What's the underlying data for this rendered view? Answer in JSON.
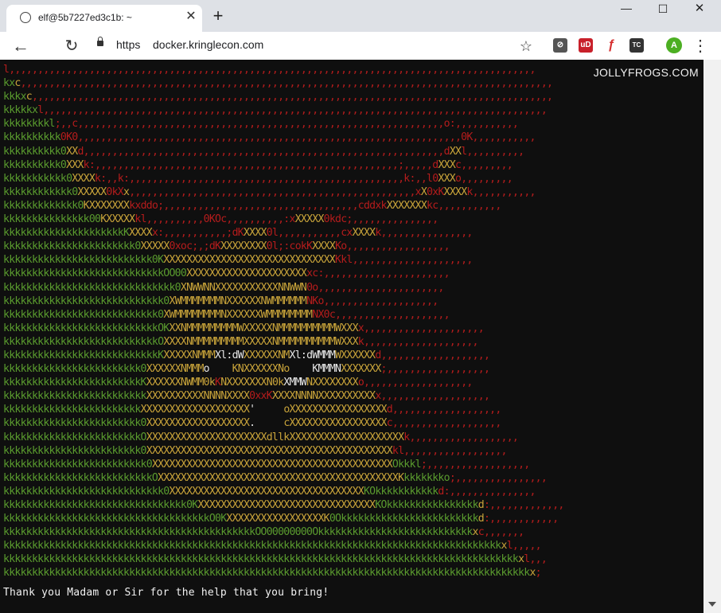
{
  "tab": {
    "title": "elf@5b7227ed3c1b: ~",
    "close_symbol": "✕",
    "new_tab_symbol": "+"
  },
  "window_controls": {
    "minimize": "—",
    "maximize": "☐",
    "close": "✕"
  },
  "toolbar": {
    "back_symbol": "←",
    "reload_symbol": "↻",
    "url_scheme": "https",
    "url_host": "docker.kringlecon.com",
    "star_symbol": "☆",
    "menu_symbol": "⋮",
    "extensions": [
      {
        "name": "privacy-extension-icon",
        "label": "⊘",
        "color": "#555555"
      },
      {
        "name": "ublock-icon",
        "label": "uD",
        "color": "#c8202a"
      },
      {
        "name": "flash-icon",
        "label": "ƒ",
        "color": "#d63030"
      },
      {
        "name": "tc-extension-icon",
        "label": "TC",
        "color": "#333333"
      }
    ],
    "profile_initial": "A",
    "profile_color": "#4caf22"
  },
  "terminal": {
    "watermark": "JOLLYFROGS.COM",
    "message": "Thank you Madam or Sir for the help that you bring!",
    "colors": {
      "background": "#0f0f0f",
      "red": "#b51c1c",
      "green": "#5a9b2e",
      "yellow": "#c9a43a",
      "white": "#e6e6e6"
    },
    "ascii_art": [
      [
        [
          "r",
          "l,,,,,,,,,,,,,,,,,,,,,,,,,,,,,,,,,,,,,,,,,,,,,,,,,,,,,,,,,,,,,,,,,,,,,,,,,,,,,,,,,,,,,,,,,,,,"
        ]
      ],
      [
        [
          "g",
          "kx"
        ],
        [
          "y",
          "c"
        ],
        [
          "r",
          ",,,,,,,,,,,,,,,,,,,,,,,,,,,,,,,,,,,,,,,,,,,,,,,,,,,,,,,,,,,,,,,,,,,,,,,,,,,,,,,,,,,,,,,,,,,,,"
        ]
      ],
      [
        [
          "g",
          "kkkx"
        ],
        [
          "y",
          "c"
        ],
        [
          "r",
          ",,,,,,,,,,,,,,,,,,,,,,,,,,,,,,,,,,,,,,,,,,,,,,,,,,,,,,,,,,,,,,,,,,,,,,,,,,,,,,,,,,,,,,,,,,,"
        ]
      ],
      [
        [
          "g",
          "kkkkkx"
        ],
        [
          "r",
          "l,,,,,,,,,,,,,,,,,,,,,,,,,,,,,,,,,,,,,,,,,,,,,,,,,,,,,,,,,,,,,,,,,,,,,,,,,,,,,,,,,,,,,,,,"
        ]
      ],
      [
        [
          "g",
          "kkkkkkkkl"
        ],
        [
          "r",
          ";,,c,,,,,,,,,,,,,,,,,,,,,,,,,,,,,,,,,,,,,,,,,,,,,,,,,,,,,,,,,,,,,,,,o:,,,,,,,,,,,"
        ]
      ],
      [
        [
          "g",
          "kkkkkkkkkk"
        ],
        [
          "r",
          "0K0,,,,,,,,,,,,,,,,,,,,,,,,,,,,,,,,,,,,,,,,,,,,,,,,,,,,,,,,,,,,,,,,,,,0K,,,,,,,,,,,"
        ]
      ],
      [
        [
          "g",
          "kkkkkkkkkk0"
        ],
        [
          "y",
          "XX"
        ],
        [
          "r",
          "d,,,,,,,,,,,,,,,,,,,,,,,,,,,,,,,,,,,,,,,,,,,,,,,,,,,,,,,,,,,,,,,d"
        ],
        [
          "y",
          "XX"
        ],
        [
          "r",
          "l,,,,,,,,,,"
        ]
      ],
      [
        [
          "g",
          "kkkkkkkkkk0"
        ],
        [
          "y",
          "XXX"
        ],
        [
          "r",
          "k:,,,,,,,,,,,,,,,,,,,,,,,,,,,,,,,,,,,,,,,,,,,,,,,,,,,,,;,,,,,d"
        ],
        [
          "y",
          "XXX"
        ],
        [
          "r",
          "c,,,,,,,,,"
        ]
      ],
      [
        [
          "g",
          "kkkkkkkkkkk0"
        ],
        [
          "y",
          "XXXX"
        ],
        [
          "r",
          "k:,,k:,,,,,,,,,,,,,,,,,,,,,,,,,,,,,,,,,,,,,,,,,,,,,,,,k:,,l0"
        ],
        [
          "y",
          "XXX"
        ],
        [
          "r",
          "o,,,,,,,,,"
        ]
      ],
      [
        [
          "g",
          "kkkkkkkkkkkk0"
        ],
        [
          "y",
          "XXXXX"
        ],
        [
          "r",
          "0kX"
        ],
        [
          "y",
          "x"
        ],
        [
          "r",
          ",,,,,,,,,,,,,,,,,,,,,,,,,,,,,,,,,,,,,,,,,,,,,,,,,,x"
        ],
        [
          "y",
          "X"
        ],
        [
          "r",
          "0xK"
        ],
        [
          "y",
          "XXXX"
        ],
        [
          "r",
          "k,,,,,,,,,,,"
        ]
      ],
      [
        [
          "g",
          "kkkkkkkkkkkkk0"
        ],
        [
          "y",
          "KXXXXXXX"
        ],
        [
          "r",
          "kxddo;,,,,,,,,,,,,,,,,,,,,,,,,,,,,,,,,,,cddxk"
        ],
        [
          "y",
          "XXXXXXX"
        ],
        [
          "r",
          "kc,,,,,,,,,,,"
        ]
      ],
      [
        [
          "g",
          "kkkkkkkkkkkkkkk00"
        ],
        [
          "y",
          "KXXXXX"
        ],
        [
          "r",
          "kl,,,,,,,,,,0KOc,,,,,,,,,,:x"
        ],
        [
          "y",
          "XXXXX"
        ],
        [
          "r",
          "0kdc;,,,,,,,,,,,,,,,"
        ]
      ],
      [
        [
          "g",
          "kkkkkkkkkkkkkkkkkkkkkK"
        ],
        [
          "y",
          "XXXX"
        ],
        [
          "r",
          "x:,,,,,,,,,,,;dK"
        ],
        [
          "y",
          "XXXX"
        ],
        [
          "r",
          "0l,,,,,,,,,,,cx"
        ],
        [
          "y",
          "XXXX"
        ],
        [
          "r",
          "k,,,,,,,,,,,,,,,,"
        ]
      ],
      [
        [
          "g",
          "kkkkkkkkkkkkkkkkkkkkkkk0"
        ],
        [
          "y",
          "XXXXX"
        ],
        [
          "r",
          "0xoc;,;dK"
        ],
        [
          "y",
          "XXXXXXXX"
        ],
        [
          "r",
          "0l;:cokK"
        ],
        [
          "y",
          "XXXX"
        ],
        [
          "r",
          "Ko,,,,,,,,,,,,,,,,,,"
        ]
      ],
      [
        [
          "g",
          "kkkkkkkkkkkkkkkkkkkkkkkkkk0K"
        ],
        [
          "y",
          "XXXXXXXXXXXXXXXXXXXXXXXXXXXXXX"
        ],
        [
          "r",
          "Kkl,,,,,,,,,,,,,,,,,,,,,"
        ]
      ],
      [
        [
          "g",
          "kkkkkkkkkkkkkkkkkkkkkkkkkkkkOO00"
        ],
        [
          "y",
          "XXXXXXXXXXXXXXXXXXXXX"
        ],
        [
          "r",
          "xc:,,,,,,,,,,,,,,,,,,,,,,"
        ]
      ],
      [
        [
          "g",
          "kkkkkkkkkkkkkkkkkkkkkkkkkkkkkk0"
        ],
        [
          "y",
          "XNWWNNXXXXXXXXXXXNNWWN"
        ],
        [
          "r",
          "0o,,,,,,,,,,,,,,,,,,,,,,"
        ]
      ],
      [
        [
          "g",
          "kkkkkkkkkkkkkkkkkkkkkkkkkkkk0"
        ],
        [
          "y",
          "XWMMMMMMMNXXXXXXNWMMMMMM"
        ],
        [
          "r",
          "NKo,,,,,,,,,,,,,,,,,,,,"
        ]
      ],
      [
        [
          "g",
          "kkkkkkkkkkkkkkkkkkkkkkkkkkk0"
        ],
        [
          "y",
          "XWMMMMMMMMNXXXXXXWMMMMMMMM"
        ],
        [
          "r",
          "NX0c,,,,,,,,,,,,,,,,,,,,"
        ]
      ],
      [
        [
          "g",
          "kkkkkkkkkkkkkkkkkkkkkkkkkkkOK"
        ],
        [
          "y",
          "XXNMMMMMMMMMWXXXXXNMMMMMMMMMMWXXX"
        ],
        [
          "r",
          "x,,,,,,,,,,,,,,,,,,,,,"
        ]
      ],
      [
        [
          "g",
          "kkkkkkkkkkkkkkkkkkkkkkkkkkkO"
        ],
        [
          "y",
          "XXXXNMMMMMMMMMXXXXXNMMMMMMMMMMWXXX"
        ],
        [
          "r",
          "k,,,,,,,,,,,,,,,,,,,,"
        ]
      ],
      [
        [
          "g",
          "kkkkkkkkkkkkkkkkkkkkkkkkkkkK"
        ],
        [
          "y",
          "XXXXXNMMM"
        ],
        [
          "w",
          "Xl:dW"
        ],
        [
          "y",
          "XXXXXXNM"
        ],
        [
          "w",
          "Xl:dWMMM"
        ],
        [
          "y",
          "WXXXXXX"
        ],
        [
          "r",
          "d,,,,,,,,,,,,,,,,,,,"
        ]
      ],
      [
        [
          "g",
          "kkkkkkkkkkkkkkkkkkkkkkkk0"
        ],
        [
          "y",
          "XXXXXXNMMM"
        ],
        [
          "w",
          "o    "
        ],
        [
          "y",
          "KNXXXXXXNo    "
        ],
        [
          "w",
          "KMMMN"
        ],
        [
          "y",
          "XXXXXXX"
        ],
        [
          "r",
          ";,,,,,,,,,,,,,,,,,,"
        ]
      ],
      [
        [
          "g",
          "kkkkkkkkkkkkkkkkkkkkkkkkK"
        ],
        [
          "y",
          "XXXXXXNWMM0k"
        ],
        [
          "r",
          "K"
        ],
        [
          "y",
          "NXXXXXXXN0k"
        ],
        [
          "w",
          "XMMW"
        ],
        [
          "y",
          "NXXXXXXXX"
        ],
        [
          "r",
          "o,,,,,,,,,,,,,,,,,,,"
        ]
      ],
      [
        [
          "g",
          "kkkkkkkkkkkkkkkkkkkkkkkkk"
        ],
        [
          "y",
          "XXXXXXXXXXNNNNXXXX"
        ],
        [
          "r",
          "0xxK"
        ],
        [
          "y",
          "XXXXNNNNXXXXXXXXXX"
        ],
        [
          "r",
          "x,,,,,,,,,,,,,,,,,,,"
        ]
      ],
      [
        [
          "g",
          "kkkkkkkkkkkkkkkkkkkkkkkk"
        ],
        [
          "y",
          "XXXXXXXXXXXXXXXXXXX"
        ],
        [
          "w",
          "'     "
        ],
        [
          "y",
          "oXXXXXXXXXXXXXXXXX"
        ],
        [
          "r",
          "d,,,,,,,,,,,,,,,,,,,"
        ]
      ],
      [
        [
          "g",
          "kkkkkkkkkkkkkkkkkkkkkkkk0"
        ],
        [
          "y",
          "XXXXXXXXXXXXXXXXXX"
        ],
        [
          "w",
          ".     "
        ],
        [
          "y",
          "cXXXXXXXXXXXXXXXXX"
        ],
        [
          "r",
          "c,,,,,,,,,,,,,,,,,,,"
        ]
      ],
      [
        [
          "g",
          "kkkkkkkkkkkkkkkkkkkkkkkkO"
        ],
        [
          "y",
          "XXXXXXXXXXXXXXXXXXXXXdllk"
        ],
        [
          "y",
          "XXXXXXXXXXXXXXXXXXXX"
        ],
        [
          "r",
          "k,,,,,,,,,,,,,,,,,,,"
        ]
      ],
      [
        [
          "g",
          "kkkkkkkkkkkkkkkkkkkkkkkk0"
        ],
        [
          "y",
          "XXXXXXXXXXXXXXXXXXXXXXXXXXXXXXXXXXXXXXXXXXX"
        ],
        [
          "r",
          "kl,,,,,,,,,,,,,,,,,,"
        ]
      ],
      [
        [
          "g",
          "kkkkkkkkkkkkkkkkkkkkkkkkk0"
        ],
        [
          "y",
          "XXXXXXXXXXXXXXXXXXXXXXXXXXXXXXXXXXXXXXXXXX"
        ],
        [
          "g",
          "Okkkl"
        ],
        [
          "r",
          ";,,,,,,,,,,,,,,,,,,"
        ]
      ],
      [
        [
          "g",
          "kkkkkkkkkkkkkkkkkkkkkkkkkkO"
        ],
        [
          "y",
          "XXXXXXXXXXXXXXXXXXXXXXXXXXXXXXXXXXXXXXXXXXK"
        ],
        [
          "g",
          "kkkkkkko"
        ],
        [
          "r",
          ";,,,,,,,,,,,,,,,,"
        ]
      ],
      [
        [
          "g",
          "kkkkkkkkkkkkkkkkkkkkkkkkkkkk0"
        ],
        [
          "y",
          "XXXXXXXXXXXXXXXXXXXXXXXXXXXXXXXXXX"
        ],
        [
          "g",
          "KOkkkkkkkkkkk"
        ],
        [
          "r",
          "d:,,,,,,,,,,,,,,,"
        ]
      ],
      [
        [
          "g",
          "kkkkkkkkkkkkkkkkkkkkkkkkkkkkkkkk0K"
        ],
        [
          "y",
          "XXXXXXXXXXXXXXXXXXXXXXXXXXXXXXX"
        ],
        [
          "g",
          "KOkkkkkkkkkkkkkkkk"
        ],
        [
          "y",
          "d"
        ],
        [
          "r",
          ":,,,,,,,,,,,,,"
        ]
      ],
      [
        [
          "g",
          "kkkkkkkkkkkkkkkkkkkkkkkkkkkkkkkkkkkkO0K"
        ],
        [
          "y",
          "XXXXXXXXXXXXXXXXXK"
        ],
        [
          "g",
          "0Okkkkkkkkkkkkkkkkkkkkkkkk"
        ],
        [
          "y",
          "d"
        ],
        [
          "r",
          ":,,,,,,,,,,,,"
        ]
      ],
      [
        [
          "g",
          "kkkkkkkkkkkkkkkkkkkkkkkkkkkkkkkkkkkkkkkkkkkkOO00000000Okkkkkkkkkkkkkkkkkkkkkkkkkkk"
        ],
        [
          "y",
          "x"
        ],
        [
          "r",
          "c,,,,,,,"
        ]
      ],
      [
        [
          "g",
          "kkkkkkkkkkkkkkkkkkkkkkkkkkkkkkkkkkkkkkkkkkkkkkkkkkkkkkkkkkkkkkkkkkkkkkkkkkkkkkkkkkkkkkk"
        ],
        [
          "y",
          "x"
        ],
        [
          "r",
          "l,,,,,"
        ]
      ],
      [
        [
          "g",
          "kkkkkkkkkkkkkkkkkkkkkkkkkkkkkkkkkkkkkkkkkkkkkkkkkkkkkkkkkkkkkkkkkkkkkkkkkkkkkkkkkkkkkkkkkk"
        ],
        [
          "y",
          "x"
        ],
        [
          "r",
          "l,,,"
        ]
      ],
      [
        [
          "g",
          "kkkkkkkkkkkkkkkkkkkkkkkkkkkkkkkkkkkkkkkkkkkkkkkkkkkkkkkkkkkkkkkkkkkkkkkkkkkkkkkkkkkkkkkkkkkk"
        ],
        [
          "y",
          "x"
        ],
        [
          "r",
          ";"
        ]
      ]
    ]
  }
}
